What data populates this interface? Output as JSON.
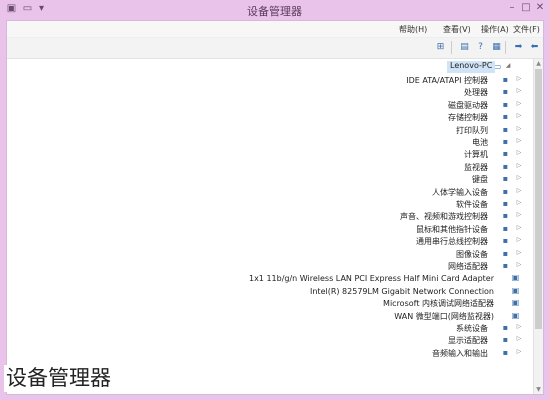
{
  "window": {
    "title": "设备管理器"
  },
  "menu": [
    "文件(F)",
    "操作(A)",
    "查看(V)",
    "帮助(H)"
  ],
  "toolbar": {
    "icons": [
      "back-icon",
      "forward-icon",
      "properties-icon",
      "help-icon",
      "show-hidden-icon",
      "scan-hardware-icon"
    ]
  },
  "tree": {
    "root": "Lenovo-PC",
    "categories": [
      "IDE ATA/ATAPI 控制器",
      "处理器",
      "磁盘驱动器",
      "存储控制器",
      "打印队列",
      "电池",
      "计算机",
      "监视器",
      "键盘",
      "人体学输入设备",
      "软件设备",
      "声音、视频和游戏控制器",
      "鼠标和其他指针设备",
      "通用串行总线控制器",
      "图像设备",
      "网络适配器"
    ],
    "network_children": [
      "1x1 11b/g/n Wireless LAN PCI Express Half Mini Card Adapter",
      "Intel(R) 82579LM Gigabit Network Connection",
      "Microsoft 内核调试网络适配器",
      "WAN 微型端口(网络监视器)"
    ],
    "after": [
      "系统设备",
      "显示适配器",
      "音频输入和输出"
    ]
  },
  "caption": "设备管理器"
}
